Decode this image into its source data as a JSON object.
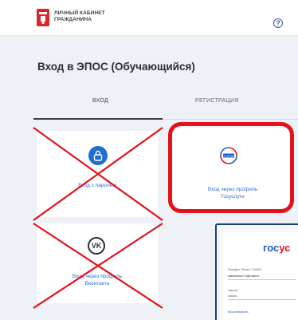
{
  "header": {
    "brand_line1": "ЛИЧНЫЙ КАБИНЕТ",
    "brand_line2": "ГРАЖДАНИНА",
    "help_glyph": "?"
  },
  "page": {
    "title": "Вход в ЭПОС (Обучающийся)"
  },
  "tabs": [
    {
      "label": "ВХОД",
      "active": true
    },
    {
      "label": "РЕГИСТРАЦИЯ",
      "active": false
    }
  ],
  "cards": {
    "password": {
      "label": "Вход с паролем",
      "crossed_out": true
    },
    "gosuslugi": {
      "label_line1": "Вход через профиль",
      "label_line2": "Госуслуги",
      "highlighted": true,
      "logo_text": "гос услуги"
    },
    "vk": {
      "label_line1": "Вход через профиль",
      "label_line2": "Вконтакте",
      "crossed_out": true,
      "icon_text": "VK"
    }
  },
  "gosuslugi_preview": {
    "brand_part1": "гос",
    "brand_part2": "ус",
    "login_label": "Телефон / Email / СНИЛС",
    "login_value": "ivanivanov71@mail.ru",
    "password_label": "Пароль",
    "password_value": "••••••••",
    "restore_link": "Восстановить"
  },
  "colors": {
    "highlight": "#e4121b",
    "accent_blue": "#1f6fd1",
    "cross_red": "#e4121b"
  }
}
